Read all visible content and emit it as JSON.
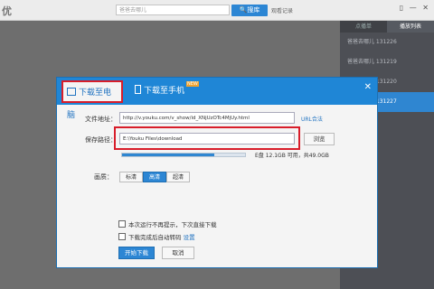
{
  "topbar": {
    "logo": "优",
    "search_placeholder": "爸爸去哪儿",
    "search_button": "搜库",
    "history": "观看记录",
    "window_controls": "▯ — ✕"
  },
  "sidebar": {
    "tabs": [
      "点播单",
      "播放列表"
    ],
    "items": [
      {
        "label": "爸爸去哪儿 131226"
      },
      {
        "label": "爸爸去哪儿 131219"
      },
      {
        "label": "爸爸去哪儿 131220"
      },
      {
        "label": "爸爸去哪儿 131227"
      }
    ],
    "active_index": 3
  },
  "dialog": {
    "tabs": {
      "pc": "下载至电脑",
      "phone": "下载至手机"
    },
    "phone_badge": "NEW",
    "close": "✕",
    "url_label": "文件地址：",
    "url_value": "http://v.youku.com/v_show/id_XNjUzOTc4MjUy.html",
    "url_help": "URL合法",
    "path_label": "保存路径：",
    "path_value": "E:\\Youku Files\\download",
    "browse_button": "浏览",
    "disk_info": "E盘 12.1GB 可用，共49.0GB",
    "disk_used_fraction": 0.75,
    "quality_label": "画质：",
    "quality_options": [
      "标清",
      "高清",
      "超清"
    ],
    "quality_selected": 1,
    "checkbox1": "本次运行不再提示，下次直接下载",
    "checkbox2": "下载完成后自动转码",
    "checkbox2_link": "设置",
    "start_button": "开始下载",
    "cancel_button": "取消"
  }
}
